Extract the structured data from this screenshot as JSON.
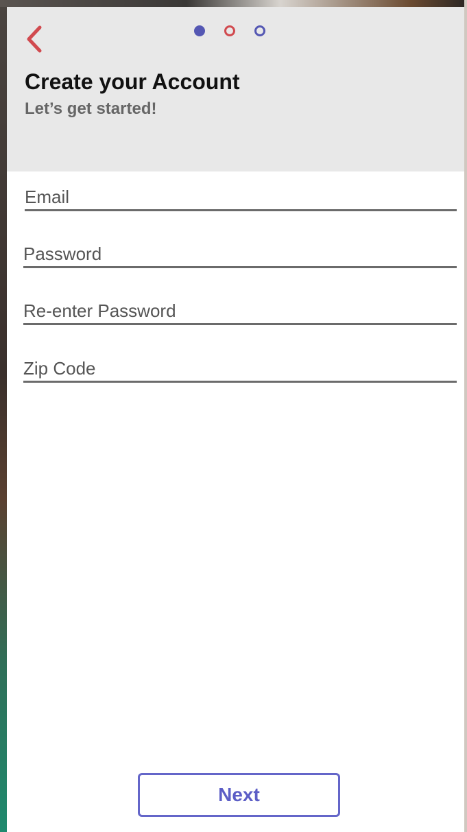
{
  "header": {
    "title": "Create your Account",
    "subtitle": "Let’s get started!",
    "back_icon": "chevron-left-icon",
    "steps": {
      "total": 3,
      "current": 1
    }
  },
  "form": {
    "email": {
      "placeholder": "Email",
      "value": ""
    },
    "password": {
      "placeholder": "Password",
      "value": ""
    },
    "reenter_password": {
      "placeholder": "Re-enter Password",
      "value": ""
    },
    "zip_code": {
      "placeholder": "Zip Code",
      "value": ""
    }
  },
  "footer": {
    "next_label": "Next"
  },
  "colors": {
    "accent": "#5457b3",
    "back": "#d14a4f",
    "header_bg": "#e8e8e8"
  }
}
